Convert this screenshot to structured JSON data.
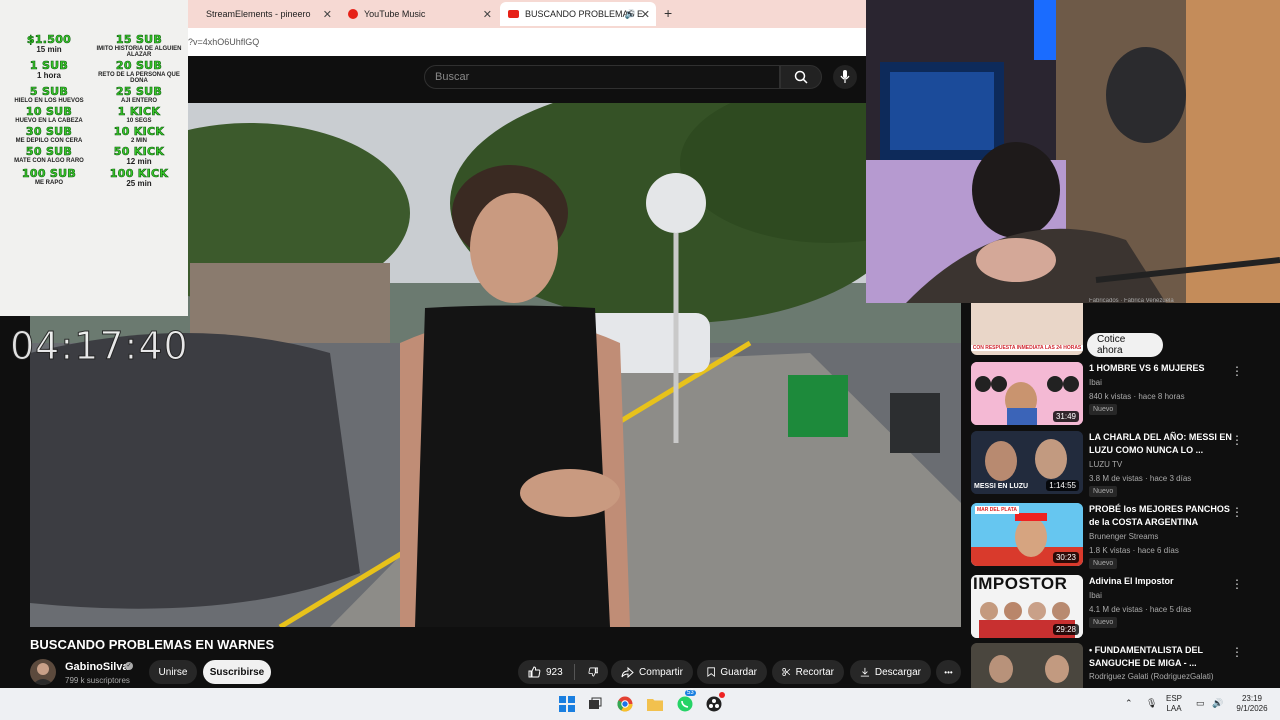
{
  "browser": {
    "tabs": [
      {
        "label": "StreamElements - pineero"
      },
      {
        "label": "YouTube Music"
      },
      {
        "label": "BUSCANDO PROBLEMAS E"
      }
    ],
    "url": "?v=4xhO6UhflGQ"
  },
  "youtube": {
    "search_placeholder": "Buscar"
  },
  "overlay": {
    "items": [
      {
        "head": "$1.500",
        "sub": "15 min"
      },
      {
        "head": "15 SUB",
        "sub": "IMITO HISTORIA DE ALGUIEN ALAZAR"
      },
      {
        "head": "1 SUB",
        "sub": "1 hora"
      },
      {
        "head": "20 SUB",
        "sub": "RETO DE LA PERSONA QUE DONA"
      },
      {
        "head": "5 SUB",
        "sub": "HIELO EN LOS HUEVOS"
      },
      {
        "head": "25 SUB",
        "sub": "AJI ENTERO"
      },
      {
        "head": "10 SUB",
        "sub": "HUEVO EN LA CABEZA"
      },
      {
        "head": "1 KICK",
        "sub": "10 SEGS"
      },
      {
        "head": "30 SUB",
        "sub": "ME DEPILO CON CERA"
      },
      {
        "head": "10 KICK",
        "sub": "2 MIN"
      },
      {
        "head": "50 SUB",
        "sub": "MATE CON ALGO RARO"
      },
      {
        "head": "50 KICK",
        "sub": "12 min"
      },
      {
        "head": "100 SUB",
        "sub": "ME RAPO"
      },
      {
        "head": "100 KICK",
        "sub": "25 min"
      }
    ],
    "timer": "04:17:40"
  },
  "video": {
    "title": "BUSCANDO PROBLEMAS EN WARNES",
    "channel": "GabinoSilva",
    "subscribers": "799 k suscriptores",
    "join_label": "Unirse",
    "subscribe_label": "Suscribirse",
    "likes": "923",
    "share_label": "Compartir",
    "save_label": "Guardar",
    "clip_label": "Recortar",
    "download_label": "Descargar",
    "more_label": "•••"
  },
  "sidebar": {
    "ad_button": "Cotice ahora",
    "ad_thumb_text": "CON RESPUESTA INMEDIATA LAS 24 HORAS",
    "ad_top_text": "Fabricados · Fábrica Venezuela",
    "recommendations": [
      {
        "title": "1 HOMBRE VS 6 MUJERES",
        "channel": "Ibai",
        "meta": "840 k vistas · hace 8 horas",
        "badge": "Nuevo",
        "duration": "31:49",
        "thumb_text": ""
      },
      {
        "title": "LA CHARLA DEL AÑO: MESSI EN LUZU COMO NUNCA LO ...",
        "channel": "LUZU TV",
        "meta": "3.8 M de vistas · hace 3 días",
        "badge": "Nuevo",
        "duration": "1:14:55",
        "thumb_text": "MESSI EN LUZU"
      },
      {
        "title": "PROBÉ los MEJORES PANCHOS de la COSTA ARGENTINA",
        "channel": "Brunenger Streams",
        "meta": "1.8 K vistas · hace 6 días",
        "badge": "Nuevo",
        "duration": "30:23",
        "thumb_text": "MAR DEL PLATA"
      },
      {
        "title": "Adivina El Impostor",
        "channel": "Ibai",
        "meta": "4.1 M de vistas · hace 5 días",
        "badge": "Nuevo",
        "duration": "29:28",
        "thumb_text": "IMPOSTOR"
      },
      {
        "title": "• FUNDAMENTALISTA DEL SANGUCHE DE MIGA - ...",
        "channel": "Rodriguez Galati (RodriguezGalati)",
        "meta": "",
        "badge": "",
        "duration": "",
        "thumb_text": ""
      }
    ]
  },
  "taskbar": {
    "lang": "ESP",
    "lang2": "LAA",
    "time": "23:19",
    "date": "9/1/2026",
    "whatsapp_badge": "53"
  }
}
